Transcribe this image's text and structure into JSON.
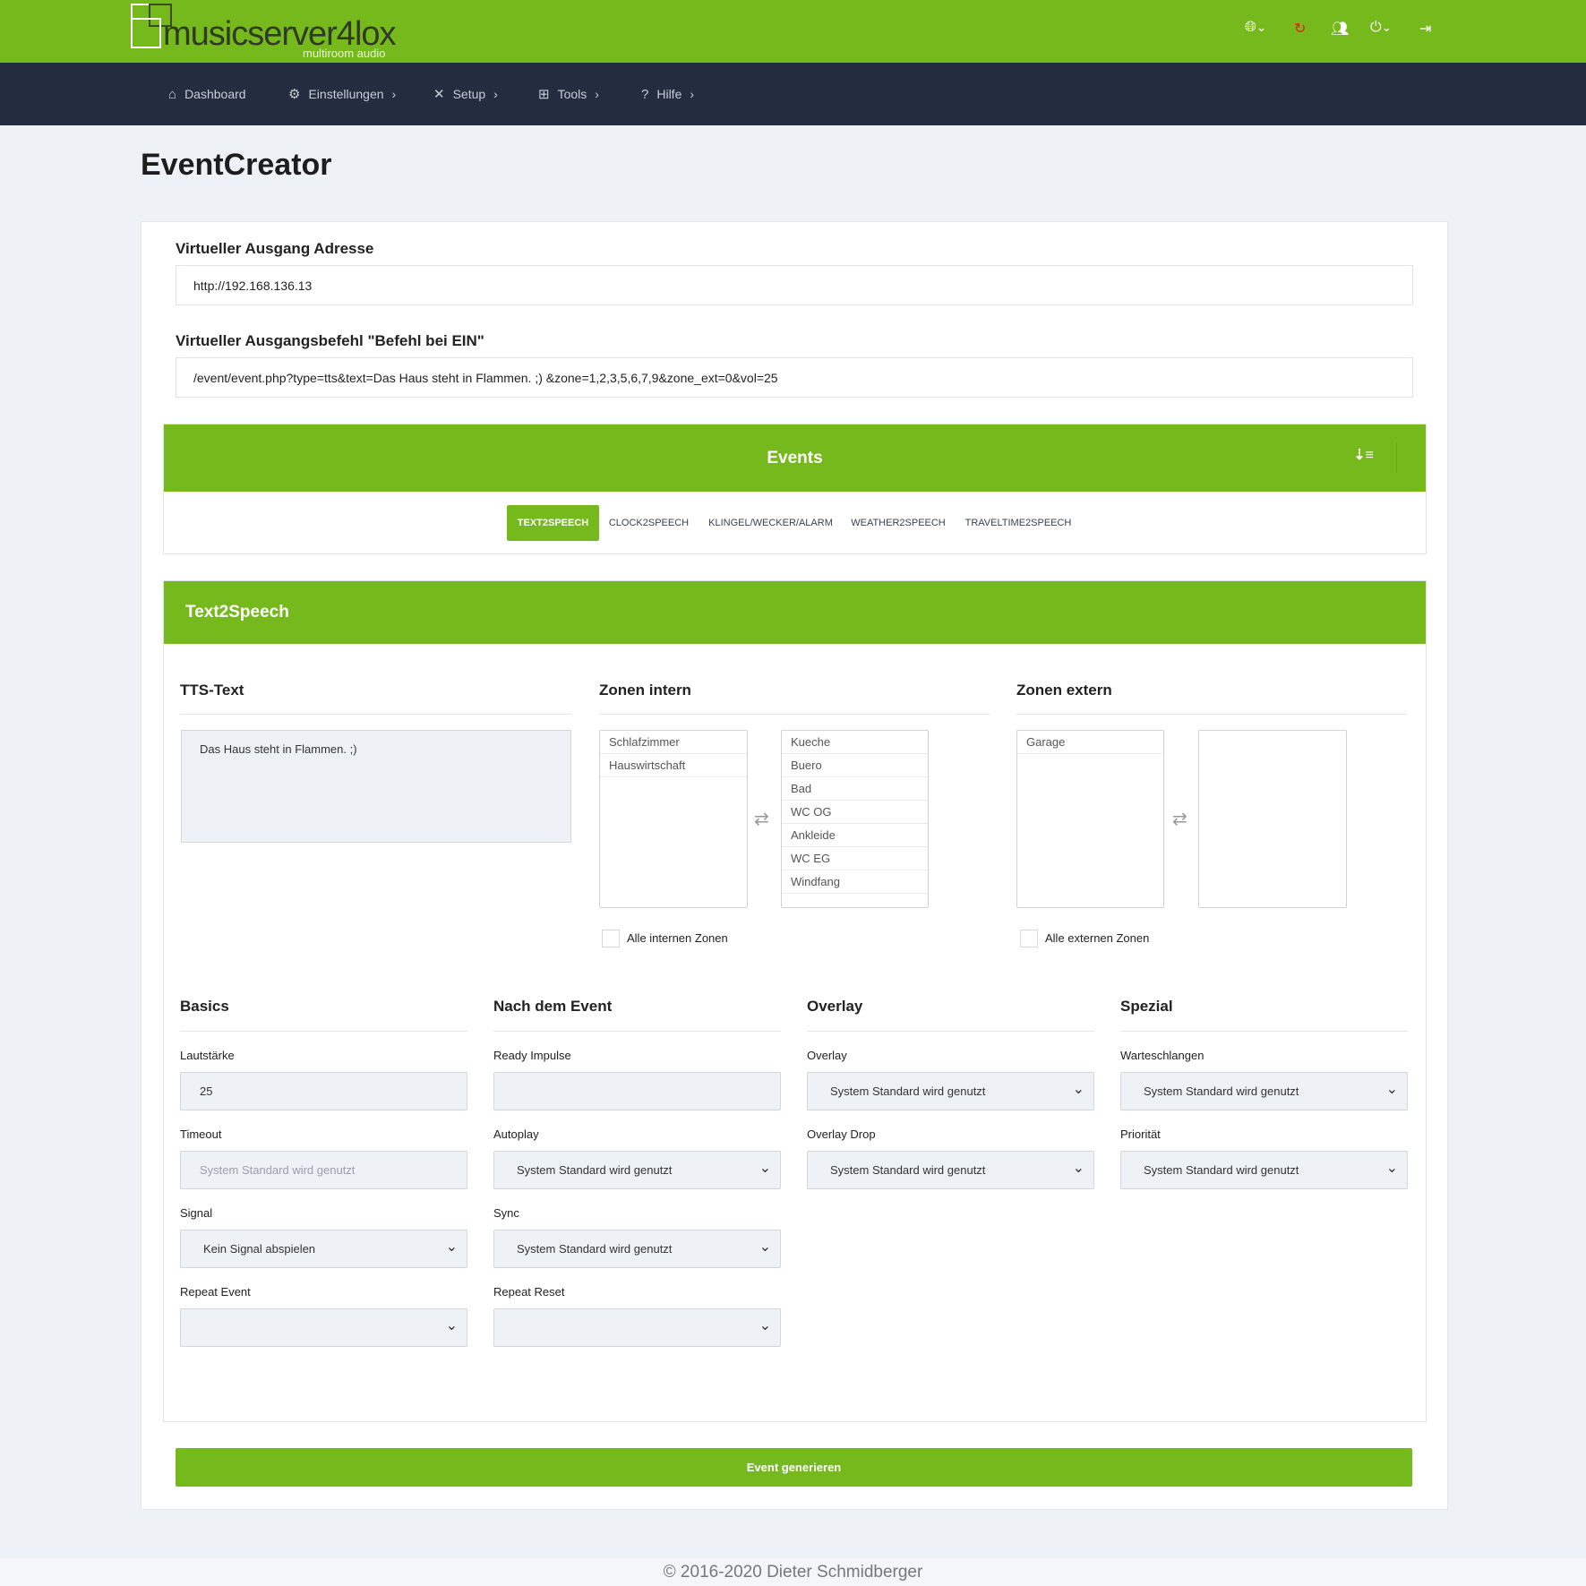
{
  "header": {
    "logo_text": "musicserver4lox",
    "logo_sub": "multiroom audio",
    "icons": [
      "globe-icon",
      "refresh-icon",
      "users-icon",
      "power-icon",
      "logout-icon"
    ],
    "accent": "#76b91c"
  },
  "nav": {
    "items": [
      {
        "label": "Dashboard",
        "icon": "home-icon"
      },
      {
        "label": "Einstellungen",
        "icon": "gear-icon"
      },
      {
        "label": "Setup",
        "icon": "tools-icon"
      },
      {
        "label": "Tools",
        "icon": "plus-square-icon"
      },
      {
        "label": "Hilfe",
        "icon": "question-icon"
      }
    ]
  },
  "page_title": "EventCreator",
  "address": {
    "label": "Virtueller Ausgang Adresse",
    "value": "http://192.168.136.13"
  },
  "command": {
    "label": "Virtueller Ausgangsbefehl \"Befehl bei EIN\"",
    "value": "/event/event.php?type=tts&text=Das Haus steht in Flammen. ;) &zone=1,2,3,5,6,7,9&zone_ext=0&vol=25"
  },
  "events": {
    "title": "Events",
    "tabs": [
      "TEXT2SPEECH",
      "CLOCK2SPEECH",
      "KLINGEL/WECKER/ALARM",
      "WEATHER2SPEECH",
      "TRAVELTIME2SPEECH"
    ],
    "active_tab": "TEXT2SPEECH"
  },
  "tts": {
    "title": "Text2Speech",
    "text_heading": "TTS-Text",
    "text_value": "Das Haus steht in Flammen. ;)",
    "zones_int": {
      "heading": "Zonen intern",
      "available": [
        "Schlafzimmer",
        "Hauswirtschaft"
      ],
      "selected": [
        "Kueche",
        "Buero",
        "Bad",
        "WC OG",
        "Ankleide",
        "WC EG",
        "Windfang"
      ],
      "all_label": "Alle internen Zonen"
    },
    "zones_ext": {
      "heading": "Zonen extern",
      "available": [
        "Garage"
      ],
      "selected": [],
      "all_label": "Alle externen Zonen"
    }
  },
  "form": {
    "basics": {
      "heading": "Basics",
      "lautstaerke_label": "Lautstärke",
      "lautstaerke": "25",
      "timeout_label": "Timeout",
      "timeout_placeholder": "System Standard wird genutzt",
      "signal_label": "Signal",
      "signal": "Kein Signal abspielen",
      "repeat_label": "Repeat Event",
      "repeat": ""
    },
    "after": {
      "heading": "Nach dem Event",
      "ready_label": "Ready Impulse",
      "ready": "",
      "autoplay_label": "Autoplay",
      "autoplay": "System Standard wird genutzt",
      "sync_label": "Sync",
      "sync": "System Standard wird genutzt",
      "reset_label": "Repeat Reset",
      "reset": ""
    },
    "overlay": {
      "heading": "Overlay",
      "overlay_label": "Overlay",
      "overlay": "System Standard wird genutzt",
      "drop_label": "Overlay Drop",
      "drop": "System Standard wird genutzt"
    },
    "special": {
      "heading": "Spezial",
      "queue_label": "Warteschlangen",
      "queue": "System Standard wird genutzt",
      "prio_label": "Priorität",
      "prio": "System Standard wird genutzt"
    }
  },
  "generate_label": "Event generieren",
  "footer": "© 2016-2020 Dieter Schmidberger"
}
